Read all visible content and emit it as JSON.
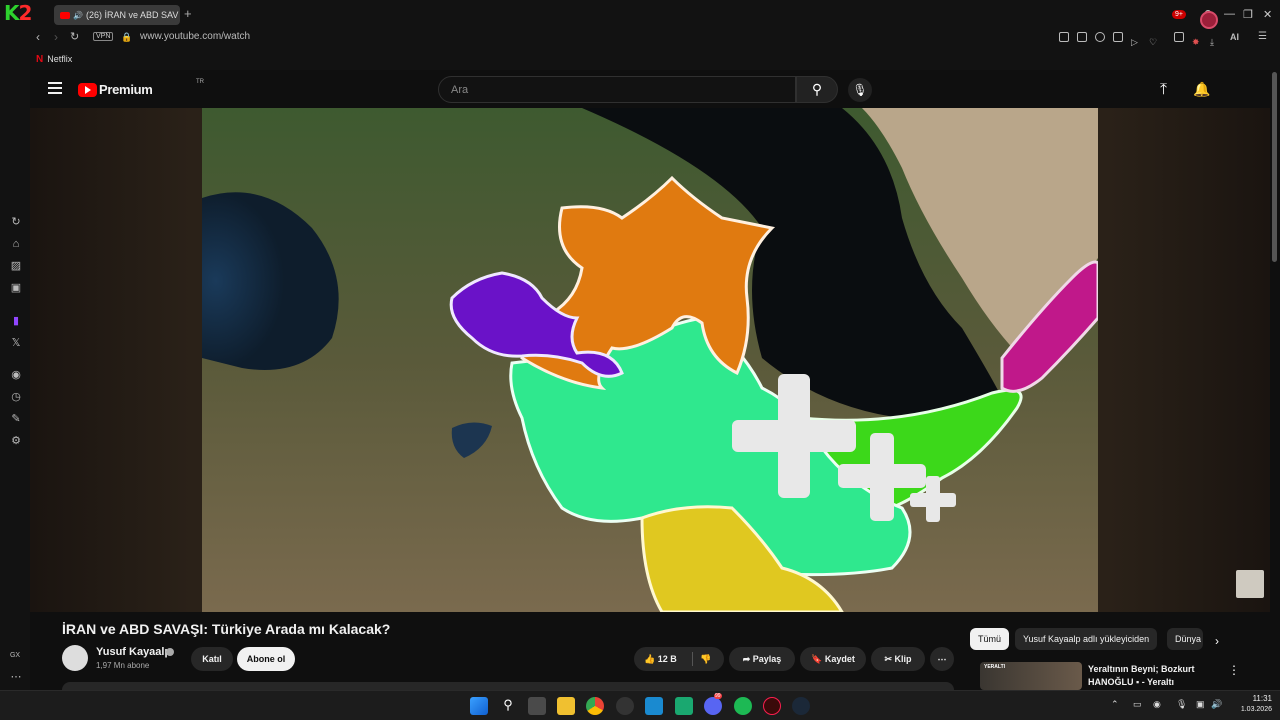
{
  "browser": {
    "logo_k": "K",
    "logo_num": "2",
    "tab_title": "(26) İRAN ve ABD SAV",
    "new_tab": "+",
    "vpn_label": "VPN",
    "url": "www.youtube.com/watch",
    "ai_label": "AI",
    "bookmark_netflix": "Netflix",
    "bookmark_netflix_icon": "N"
  },
  "youtube": {
    "logo_word": "Premium",
    "country_code": "TR",
    "search_placeholder": "Ara",
    "notification_badge": "9+"
  },
  "video": {
    "title": "İRAN ve ABD SAVAŞI: Türkiye Arada mı Kalacak?",
    "channel_name": "Yusuf Kayaalp",
    "subscribers": "1,97 Mn abone",
    "join_label": "Katıl",
    "subscribe_label": "Abone ol",
    "like_count": "12 B",
    "share_label": "Paylaş",
    "save_label": "Kaydet",
    "clip_label": "Klip"
  },
  "chips": [
    "Tümü",
    "Yusuf Kayaalp adlı yükleyiciden",
    "Dünya"
  ],
  "recommendation": {
    "thumb_label": "YERALTI",
    "title": "Yeraltının Beyni; Bozkurt HANOĞLU ▪ - Yeraltı"
  },
  "sidebar": {
    "gx_label": "GX"
  },
  "taskbar": {
    "time": "11:31",
    "date": "1.03.2026",
    "discord_badge": "99"
  },
  "colors": {
    "yt_red": "#ff0000",
    "armenia": "#6a12c8",
    "azerbaijan": "#e07a10",
    "iran": "#2fe88e",
    "turkmenistan": "#3cd81a",
    "kazakhstan": "#c0188a",
    "iraq": "#e0c820"
  }
}
